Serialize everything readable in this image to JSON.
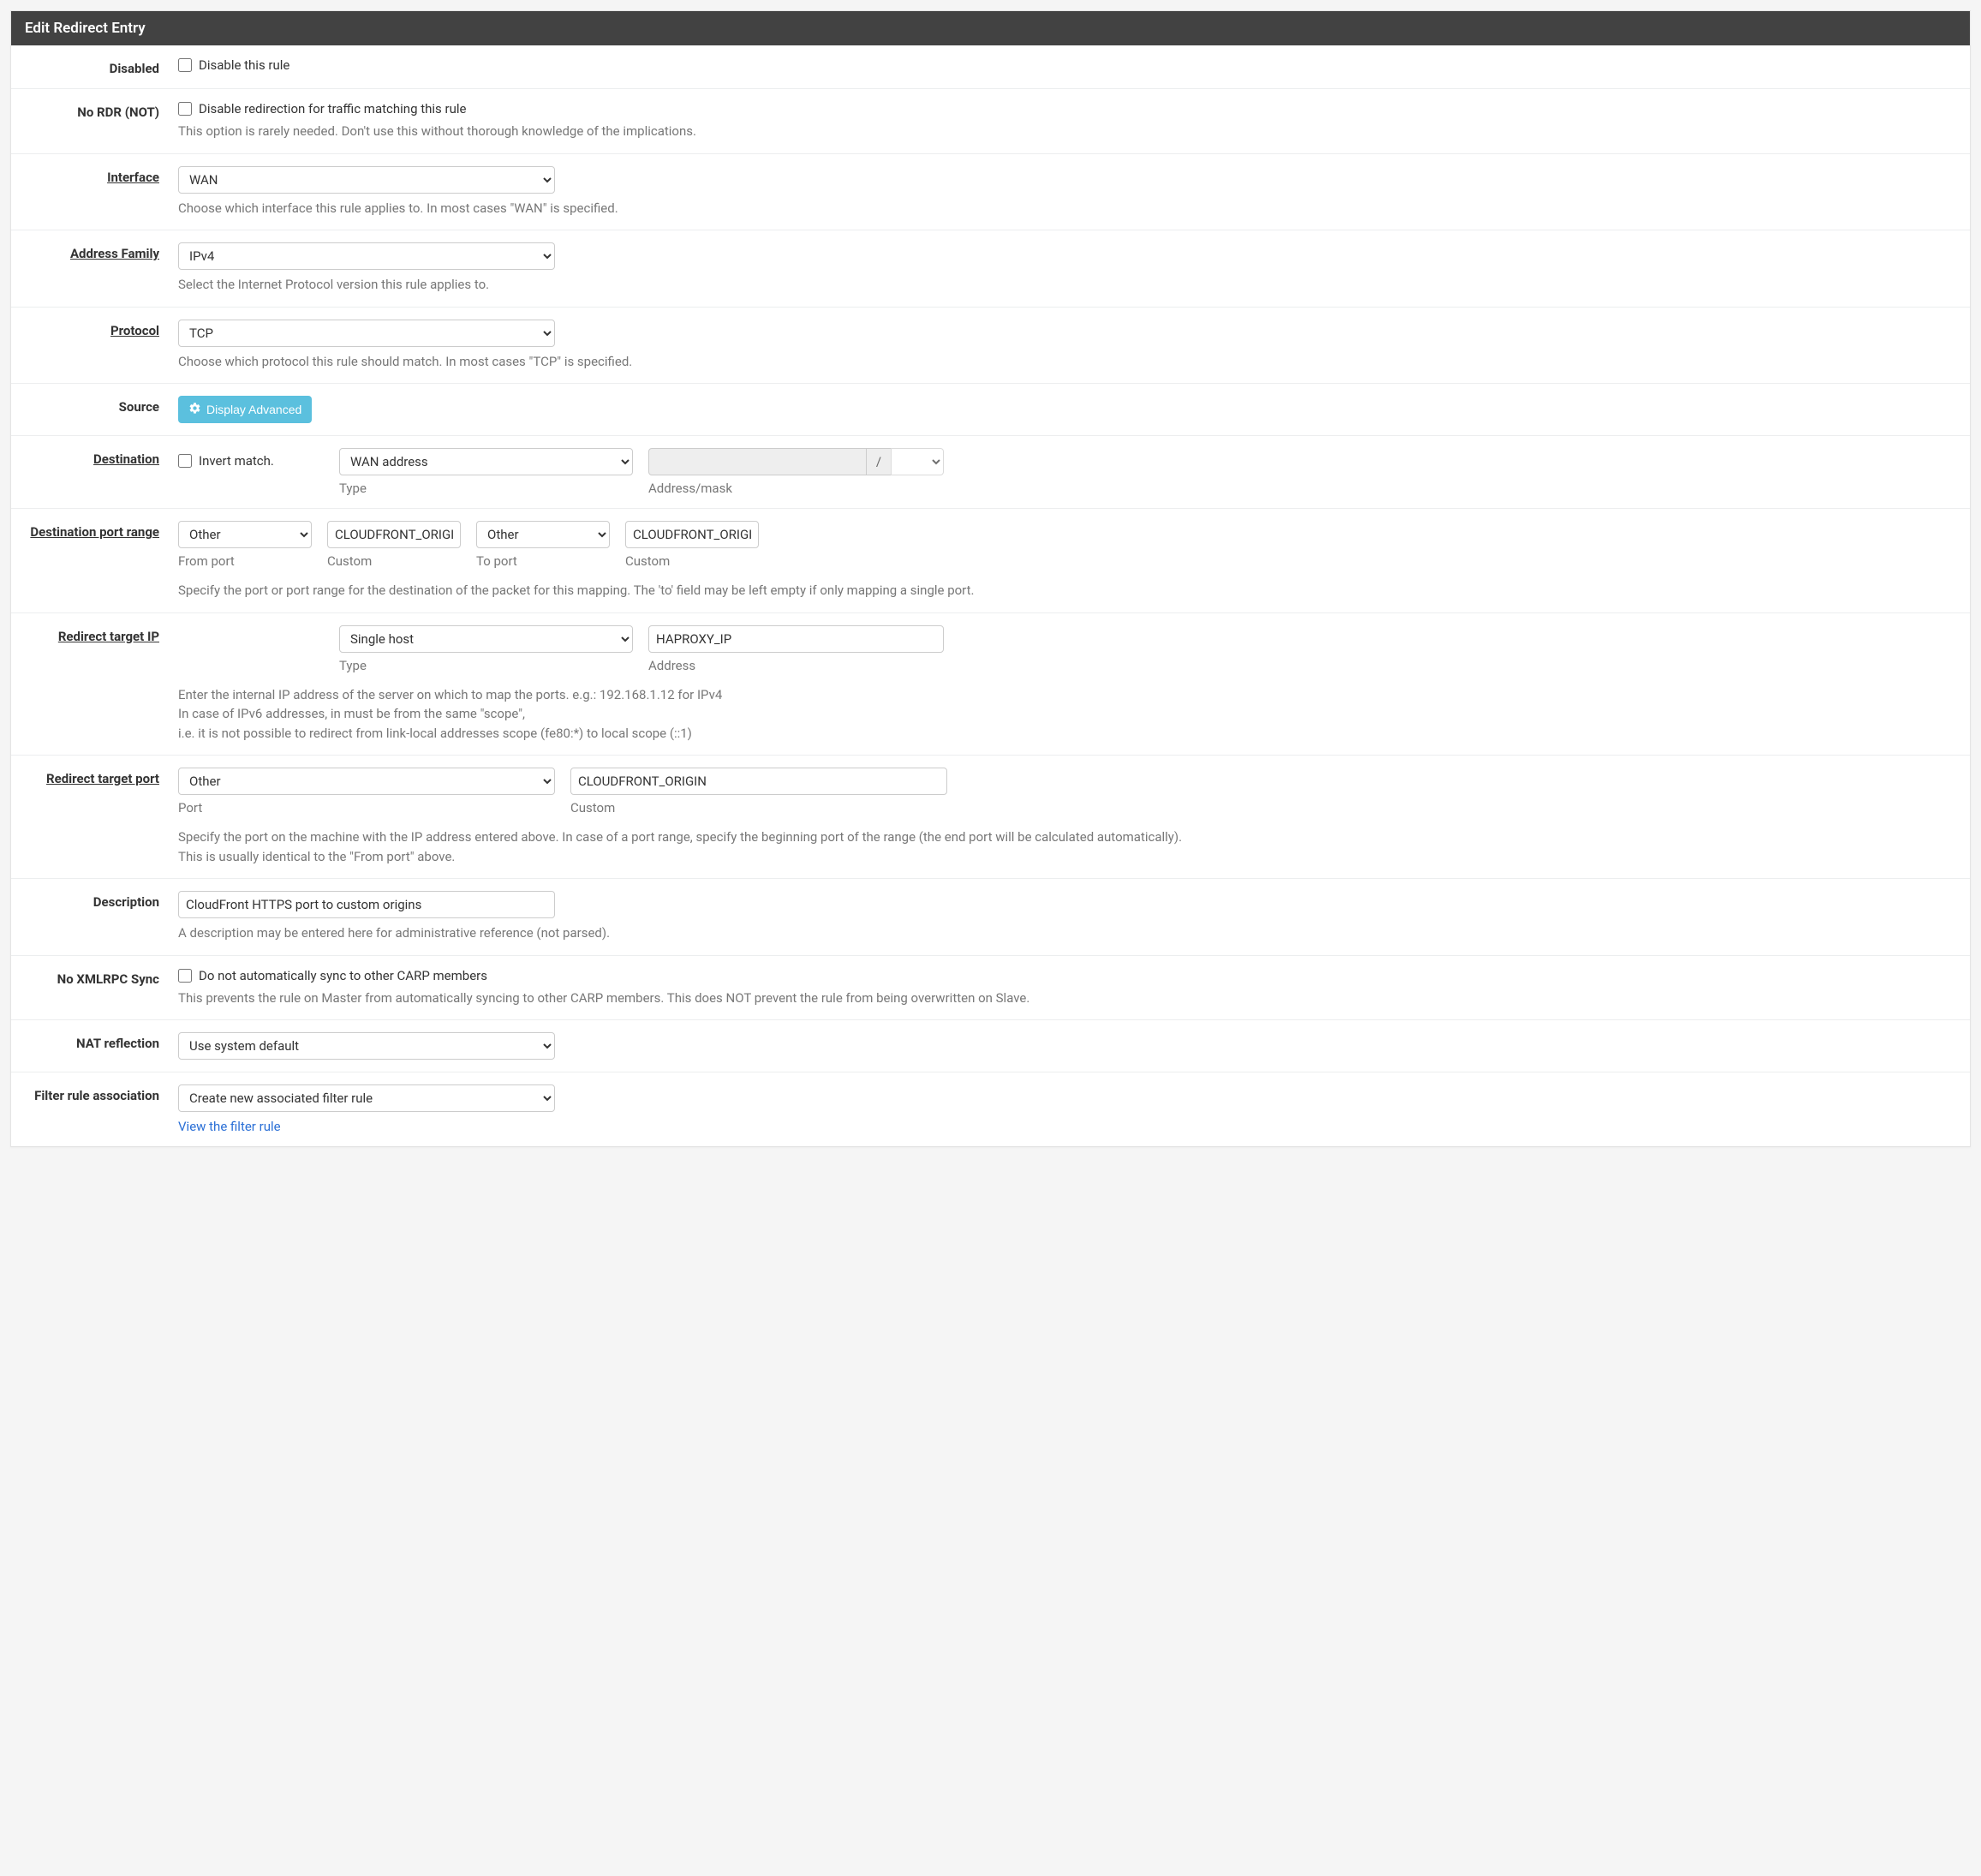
{
  "panelTitle": "Edit Redirect Entry",
  "rows": {
    "disabled": {
      "label": "Disabled",
      "checkbox": "Disable this rule"
    },
    "nordr": {
      "label": "No RDR (NOT)",
      "checkbox": "Disable redirection for traffic matching this rule",
      "help": "This option is rarely needed. Don't use this without thorough knowledge of the implications."
    },
    "interface": {
      "label": "Interface",
      "value": "WAN",
      "help": "Choose which interface this rule applies to. In most cases \"WAN\" is specified."
    },
    "addressFamily": {
      "label": "Address Family",
      "value": "IPv4",
      "help": "Select the Internet Protocol version this rule applies to."
    },
    "protocol": {
      "label": "Protocol",
      "value": "TCP",
      "help": "Choose which protocol this rule should match. In most cases \"TCP\" is specified."
    },
    "source": {
      "label": "Source",
      "button": "Display Advanced"
    },
    "destination": {
      "label": "Destination",
      "invert": "Invert match.",
      "typeValue": "WAN address",
      "typeLabel": "Type",
      "maskValue": "",
      "maskSlash": "/",
      "maskSelect": "",
      "maskLabel": "Address/mask"
    },
    "destPortRange": {
      "label": "Destination port range",
      "fromPortValue": "Other",
      "fromPortLabel": "From port",
      "fromCustomValue": "CLOUDFRONT_ORIGIN",
      "fromCustomLabel": "Custom",
      "toPortValue": "Other",
      "toPortLabel": "To port",
      "toCustomValue": "CLOUDFRONT_ORIGIN",
      "toCustomLabel": "Custom",
      "help": "Specify the port or port range for the destination of the packet for this mapping. The 'to' field may be left empty if only mapping a single port."
    },
    "redirectTargetIp": {
      "label": "Redirect target IP",
      "typeValue": "Single host",
      "typeLabel": "Type",
      "addressValue": "HAPROXY_IP",
      "addressLabel": "Address",
      "help": "Enter the internal IP address of the server on which to map the ports. e.g.: 192.168.1.12 for IPv4\nIn case of IPv6 addresses, in must be from the same \"scope\",\ni.e. it is not possible to redirect from link-local addresses scope (fe80:*) to local scope (::1)"
    },
    "redirectTargetPort": {
      "label": "Redirect target port",
      "portValue": "Other",
      "portLabel": "Port",
      "customValue": "CLOUDFRONT_ORIGIN",
      "customLabel": "Custom",
      "help": "Specify the port on the machine with the IP address entered above. In case of a port range, specify the beginning port of the range (the end port will be calculated automatically).\nThis is usually identical to the \"From port\" above."
    },
    "description": {
      "label": "Description",
      "value": "CloudFront HTTPS port to custom origins",
      "help": "A description may be entered here for administrative reference (not parsed)."
    },
    "noXmlrpc": {
      "label": "No XMLRPC Sync",
      "checkbox": "Do not automatically sync to other CARP members",
      "help": "This prevents the rule on Master from automatically syncing to other CARP members. This does NOT prevent the rule from being overwritten on Slave."
    },
    "natReflection": {
      "label": "NAT reflection",
      "value": "Use system default"
    },
    "filterRuleAssoc": {
      "label": "Filter rule association",
      "value": "Create new associated filter rule",
      "link": "View the filter rule"
    }
  }
}
